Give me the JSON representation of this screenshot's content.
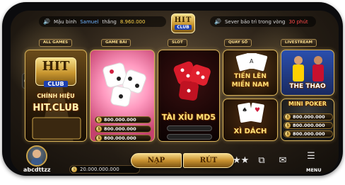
{
  "ticker": {
    "prefix": "Mậu binh",
    "user": "Samuel",
    "verb": "thắng",
    "amount": "8.960.000"
  },
  "announcement": {
    "text": "Sever bảo trì trong vòng",
    "highlight": "30 phút"
  },
  "logo": {
    "line1": "HIT",
    "line2": "CLUB"
  },
  "tabs": {
    "all_games": "ALL GAMES",
    "game_bai": "GAME BÀI",
    "slot": "SLOT",
    "quay_so": "QUAY SỐ",
    "livestream": "LIVESTREAM"
  },
  "cards": {
    "featured": {
      "logo1": "HIT",
      "logo2": "CLUB",
      "line1": "CHÍNH HIỆU",
      "line2": "HIT.CLUB"
    },
    "dice": {
      "jackpots": [
        "800.000.000",
        "800.000.000",
        "800.000.000"
      ]
    },
    "taixiu": {
      "title": "TÀI XỈU MD5"
    },
    "tienlen": {
      "line1": "TIẾN LÊN",
      "line2": "MIỀN NAM"
    },
    "xidach": {
      "title": "XÌ DÁCH"
    },
    "sport": {
      "title": "THE THAO"
    },
    "minipoker": {
      "title": "MINI POKER",
      "jackpots": [
        "800.000.000",
        "800.000.000",
        "800.000.000"
      ]
    }
  },
  "user": {
    "name": "abcdttzz",
    "balance": "20.000.000.000"
  },
  "buttons": {
    "nap": "NẠP",
    "rut": "RÚT",
    "menu": "MENU"
  },
  "colors": {
    "gold": "#d8b35a",
    "accent_blue": "#6fb3ff",
    "warn_red": "#ff4a4a"
  }
}
